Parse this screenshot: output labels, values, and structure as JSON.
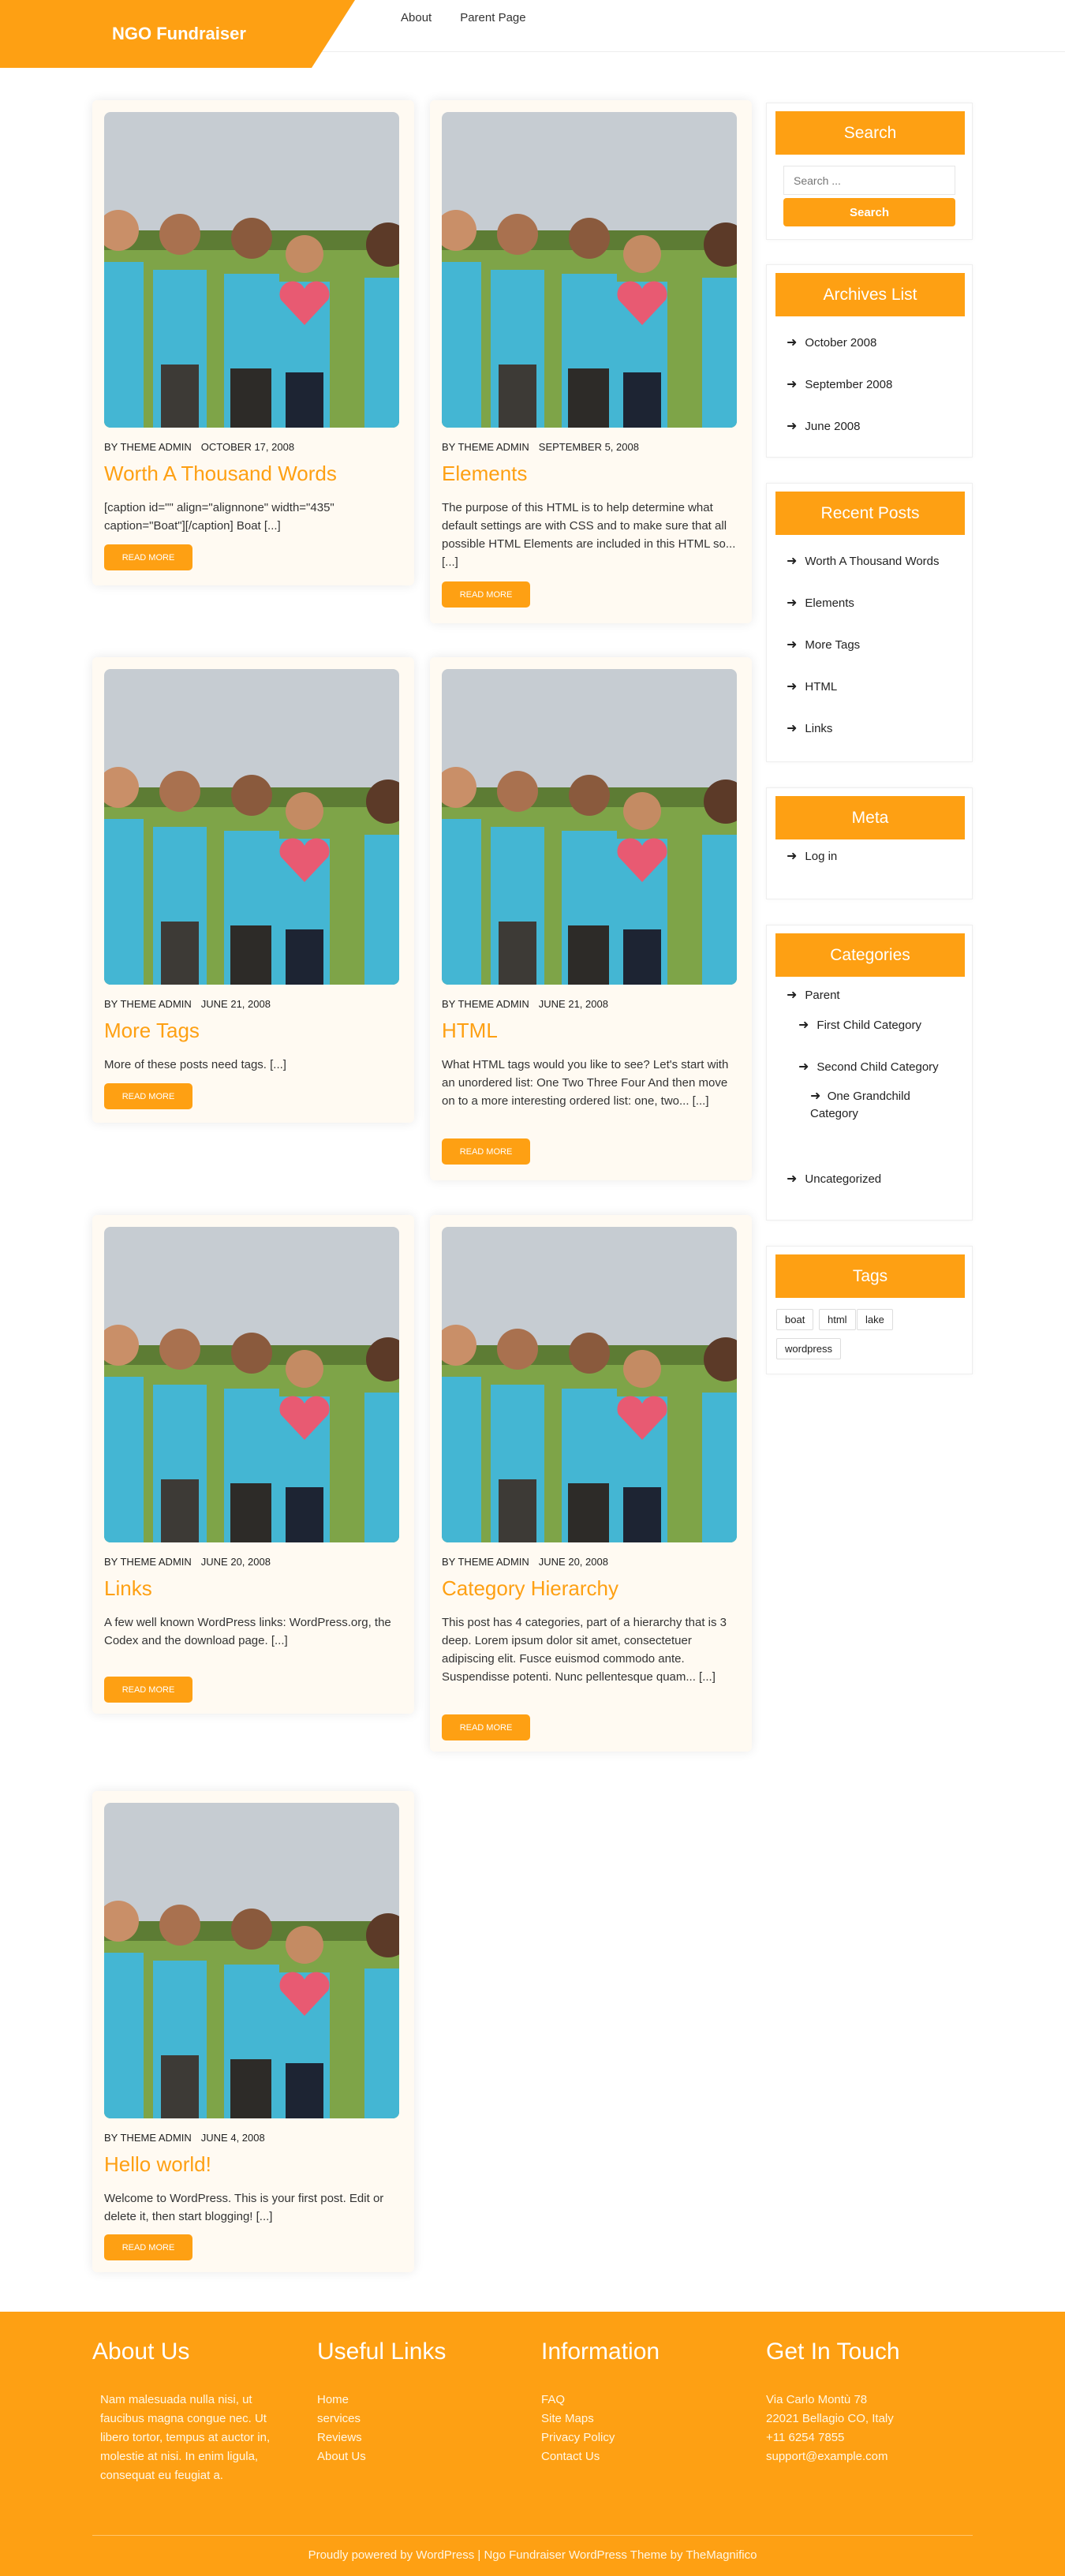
{
  "header": {
    "site_title": "NGO Fundraiser",
    "nav": [
      {
        "label": "About"
      },
      {
        "label": "Parent Page"
      }
    ]
  },
  "posts": [
    {
      "author": "BY THEME ADMIN",
      "date": "OCTOBER 17, 2008",
      "title": "Worth A Thousand Words",
      "excerpt": "[caption id=\"\" align=\"alignnone\" width=\"435\" caption=\"Boat\"][/caption] Boat [...]",
      "read_more": "READ MORE"
    },
    {
      "author": "BY THEME ADMIN",
      "date": "SEPTEMBER 5, 2008",
      "title": "Elements",
      "excerpt": "The purpose of this HTML is to help determine what default settings are with CSS and to make sure that all possible HTML Elements are included in this HTML so... [...]",
      "read_more": "READ MORE"
    },
    {
      "author": "BY THEME ADMIN",
      "date": "JUNE 21, 2008",
      "title": "More Tags",
      "excerpt": "More of these posts need tags. [...]",
      "read_more": "READ MORE"
    },
    {
      "author": "BY THEME ADMIN",
      "date": "JUNE 21, 2008",
      "title": "HTML",
      "excerpt": "What HTML tags would you like to see? Let's start with an unordered list: One Two Three Four And then move on to a more interesting ordered list: one, two... [...]",
      "read_more": "READ MORE"
    },
    {
      "author": "BY THEME ADMIN",
      "date": "JUNE 20, 2008",
      "title": "Links",
      "excerpt": "A few well known WordPress links: WordPress.org, the Codex and the download page. [...]",
      "read_more": "READ MORE"
    },
    {
      "author": "BY THEME ADMIN",
      "date": "JUNE 20, 2008",
      "title": "Category Hierarchy",
      "excerpt": "This post has 4 categories, part of a hierarchy that is 3 deep. Lorem ipsum dolor sit amet, consectetuer adipiscing elit. Fusce euismod commodo ante. Suspendisse potenti. Nunc pellentesque quam... [...]",
      "read_more": "READ MORE"
    },
    {
      "author": "BY THEME ADMIN",
      "date": "JUNE 4, 2008",
      "title": "Hello world!",
      "excerpt": "Welcome to WordPress. This is your first post. Edit or delete it, then start blogging! [...]",
      "read_more": "READ MORE"
    }
  ],
  "sidebar": {
    "search": {
      "title": "Search",
      "placeholder": "Search ...",
      "button": "Search"
    },
    "archives": {
      "title": "Archives List",
      "items": [
        "October 2008",
        "September 2008",
        "June 2008"
      ]
    },
    "recent": {
      "title": "Recent Posts",
      "items": [
        "Worth A Thousand Words",
        "Elements",
        "More Tags",
        "HTML",
        "Links"
      ]
    },
    "meta": {
      "title": "Meta",
      "items": [
        "Log in"
      ]
    },
    "categories": {
      "title": "Categories",
      "items": [
        "Parent",
        "First Child Category",
        "Second Child Category",
        "One Grandchild Category",
        "Uncategorized"
      ]
    },
    "tags": {
      "title": "Tags",
      "items": [
        "boat",
        "html",
        "lake",
        "wordpress"
      ]
    }
  },
  "footer": {
    "about": {
      "title": "About Us",
      "text": "Nam malesuada nulla nisi, ut faucibus magna congue nec. Ut libero tortor, tempus at auctor in, molestie at nisi. In enim ligula, consequat eu feugiat a."
    },
    "useful": {
      "title": "Useful Links",
      "items": [
        "Home",
        "services",
        "Reviews",
        "About Us"
      ]
    },
    "info": {
      "title": "Information",
      "items": [
        "FAQ",
        "Site Maps",
        "Privacy Policy",
        "Contact Us"
      ]
    },
    "contact": {
      "title": "Get In Touch",
      "items": [
        "Via Carlo Montù 78",
        "22021 Bellagio CO, Italy",
        "+11 6254 7855",
        "support@example.com"
      ]
    },
    "copyright": "Proudly powered by WordPress | Ngo Fundraiser WordPress Theme by TheMagnifico"
  },
  "colors": {
    "accent": "#fea013"
  }
}
